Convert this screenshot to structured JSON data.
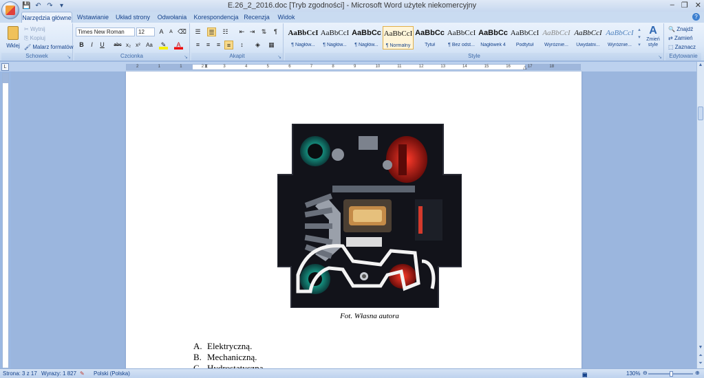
{
  "window": {
    "title": "E.26_2_2016.doc [Tryb zgodności] - Microsoft Word użytek niekomercyjny",
    "controls": [
      "–",
      "❐",
      "✕"
    ]
  },
  "qat": {
    "save": "💾",
    "undo": "↶",
    "redo": "↷",
    "more": "▾"
  },
  "tabs": [
    "Narzędzia główne",
    "Wstawianie",
    "Układ strony",
    "Odwołania",
    "Korespondencja",
    "Recenzja",
    "Widok"
  ],
  "ribbon": {
    "clipboard": {
      "paste": "Wklej",
      "cut": "Wytnij",
      "copy": "Kopiuj",
      "painter": "Malarz formatów",
      "label": "Schowek"
    },
    "font": {
      "name": "Times New Roman",
      "size": "12",
      "label": "Czcionka",
      "buttons": [
        "B",
        "I",
        "U",
        "abc",
        "x₂",
        "x²",
        "Aa"
      ]
    },
    "paragraph": {
      "label": "Akapit"
    },
    "styles": {
      "label": "Style",
      "items": [
        {
          "sample": "AaBbCcI",
          "name": "¶ Nagłów..."
        },
        {
          "sample": "AaBbCcI",
          "name": "¶ Nagłów..."
        },
        {
          "sample": "AaBbCc",
          "name": "¶ Nagłów..."
        },
        {
          "sample": "AaBbCcI",
          "name": "¶ Normalny"
        },
        {
          "sample": "AaBbCc",
          "name": "Tytuł"
        },
        {
          "sample": "AaBbCcI",
          "name": "¶ Bez odst..."
        },
        {
          "sample": "AaBbCc",
          "name": "Nagłówek 4"
        },
        {
          "sample": "AaBbCcI",
          "name": "Podtytuł"
        },
        {
          "sample": "AaBbCcI",
          "name": "Wyróżnie..."
        },
        {
          "sample": "AaBbCcI",
          "name": "Uwydatni..."
        },
        {
          "sample": "AaBbCcI",
          "name": "Wyróżnie..."
        }
      ],
      "change": "Zmień style"
    },
    "editing": {
      "find": "Znajdź",
      "replace": "Zamień",
      "select": "Zaznacz",
      "label": "Edytowanie"
    }
  },
  "ruler_ticks": [
    "2",
    "1",
    "1",
    "2",
    "3",
    "4",
    "5",
    "6",
    "7",
    "8",
    "9",
    "10",
    "11",
    "12",
    "13",
    "14",
    "15",
    "16",
    "17",
    "18"
  ],
  "document": {
    "caption": "Fot. Własna autora",
    "answers": [
      {
        "letter": "A.",
        "text": "Elektryczną."
      },
      {
        "letter": "B.",
        "text": "Mechaniczną."
      },
      {
        "letter": "C.",
        "text": "Hydrostatyczną."
      }
    ]
  },
  "status": {
    "page": "Strona: 3 z 17",
    "words": "Wyrazy: 1 827",
    "lang": "Polski (Polska)",
    "zoom": "130%"
  }
}
